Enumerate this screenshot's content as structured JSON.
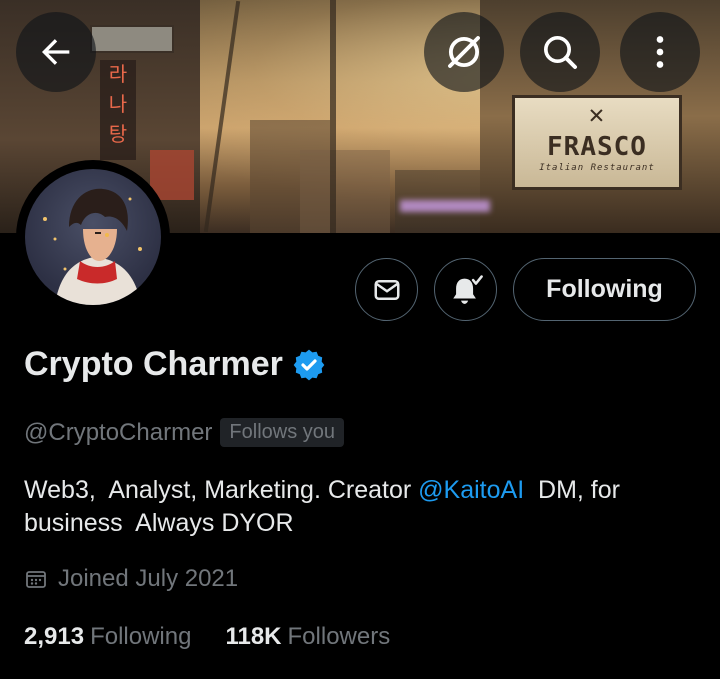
{
  "header": {
    "back_icon": "arrow-left-icon",
    "grok_icon": "grok-icon",
    "search_icon": "search-icon",
    "more_icon": "more-vertical-icon",
    "banner_sign": {
      "main": "FRASCO",
      "sub": "Italian Restaurant",
      "korean": [
        "라",
        "나",
        "탕"
      ]
    }
  },
  "profile": {
    "name": "Crypto Charmer",
    "handle": "@CryptoCharmer",
    "follows_you": "Follows you",
    "verified": true,
    "bio_before": "Web3,  Analyst, Marketing. Creator ",
    "bio_mention": "@KaitoAI",
    "bio_after": "  DM, for business  Always DYOR",
    "joined": "Joined July 2021",
    "following_count": "2,913",
    "following_label": "Following",
    "followers_count": "118K",
    "followers_label": "Followers"
  },
  "actions": {
    "message_icon": "envelope-icon",
    "notify_icon": "bell-check-icon",
    "following_button": "Following"
  },
  "colors": {
    "background": "#000000",
    "text": "#e7e9ea",
    "secondary": "#71767b",
    "accent": "#1d9bf0",
    "border": "#536471"
  }
}
